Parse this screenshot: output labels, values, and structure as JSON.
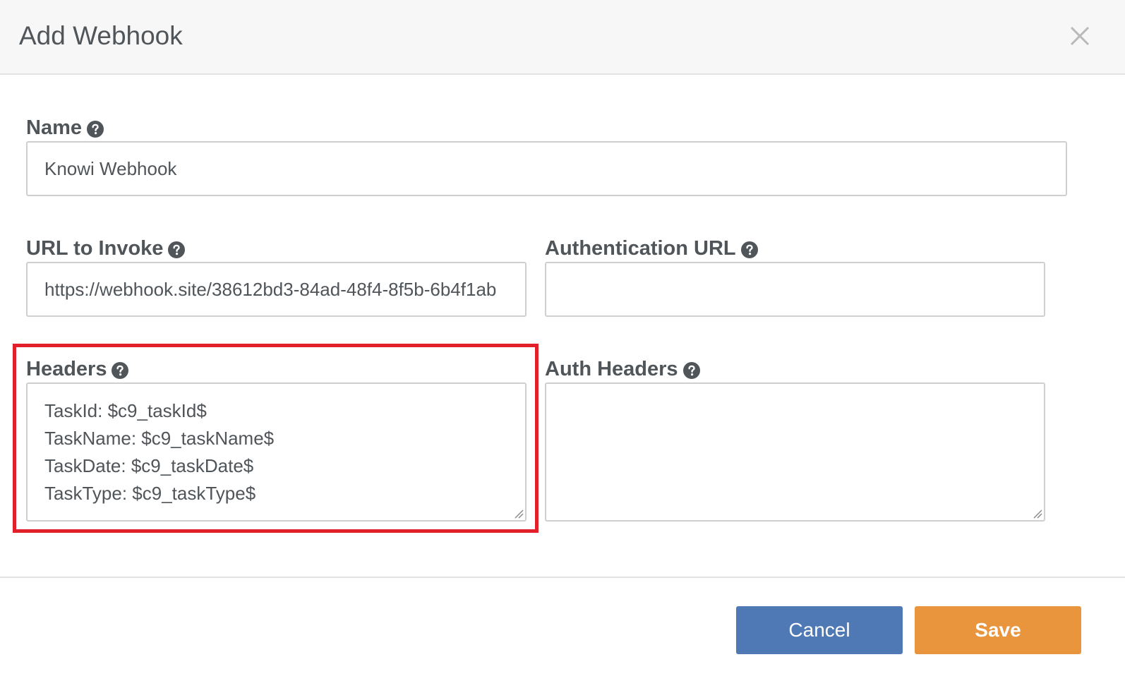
{
  "dialog": {
    "title": "Add Webhook"
  },
  "fields": {
    "name": {
      "label": "Name",
      "value": "Knowi Webhook"
    },
    "url": {
      "label": "URL to Invoke",
      "value": "https://webhook.site/38612bd3-84ad-48f4-8f5b-6b4f1ab"
    },
    "auth_url": {
      "label": "Authentication URL",
      "value": ""
    },
    "headers": {
      "label": "Headers",
      "value": "TaskId: $c9_taskId$\nTaskName: $c9_taskName$\nTaskDate: $c9_taskDate$\nTaskType: $c9_taskType$"
    },
    "auth_headers": {
      "label": "Auth Headers",
      "value": ""
    }
  },
  "buttons": {
    "cancel_label": "Cancel",
    "save_label": "Save"
  },
  "colors": {
    "cancel": "#4f79b4",
    "save": "#e8953e",
    "highlight": "#e2202a"
  },
  "icons": {
    "help": "question-circle-icon",
    "close": "close-icon"
  }
}
